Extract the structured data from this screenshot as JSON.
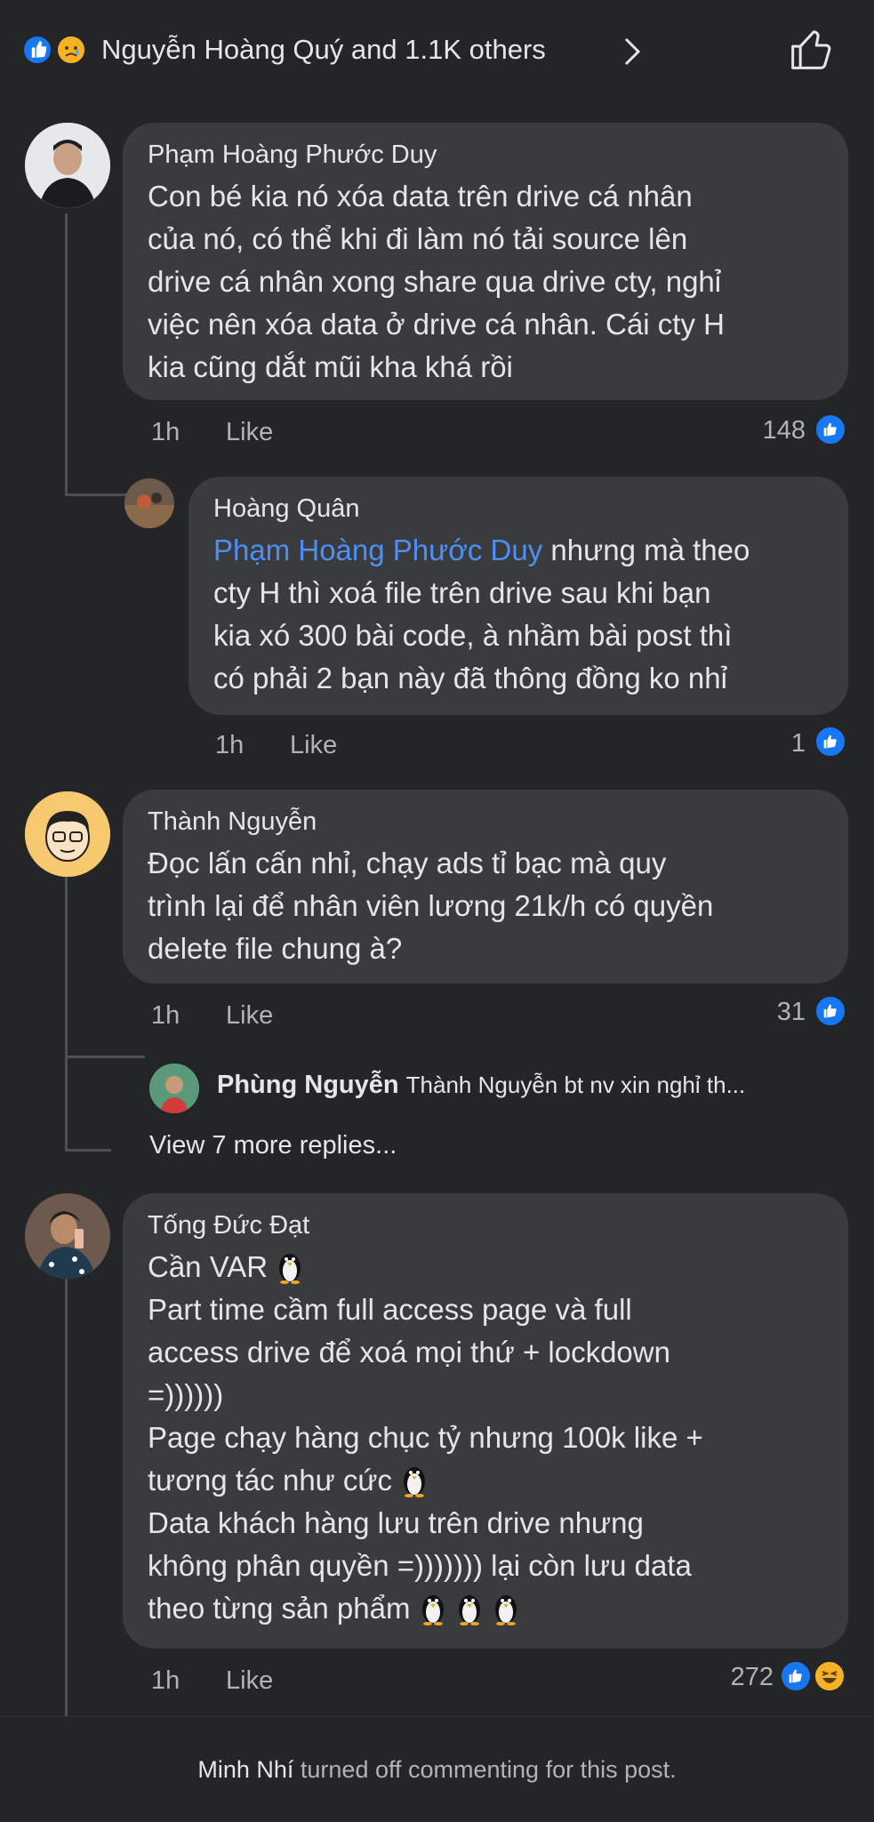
{
  "header": {
    "reaction_icons": [
      "like-icon",
      "sad-icon"
    ],
    "reactors_text": "Nguyễn Hoàng Quý and 1.1K others"
  },
  "comments": [
    {
      "author": "Phạm Hoàng Phước Duy",
      "text": "Con bé kia nó xóa data trên drive cá nhân\ncủa nó, có thể khi đi làm nó tải source lên\ndrive cá nhân xong share qua drive cty, nghỉ\nviệc nên xóa data ở drive cá nhân. Cái cty H\nkia cũng dắt mũi kha khá rồi",
      "time": "1h",
      "like_label": "Like",
      "reaction_count": "148"
    },
    {
      "author": "Hoàng Quân",
      "mention": "Phạm Hoàng Phước Duy",
      "text_line1_rest": " nhưng mà theo",
      "text_rest": "cty H thì xoá file trên drive sau khi bạn\nkia xó 300 bài code, à nhầm bài post thì\ncó phải 2 bạn này đã thông đồng ko nhỉ",
      "time": "1h",
      "like_label": "Like",
      "reaction_count": "1"
    },
    {
      "author": "Thành Nguyễn",
      "text": "Đọc lấn cấn nhỉ, chạy ads tỉ bạc mà quy\ntrình lại để nhân viên lương 21k/h có quyền\ndelete file chung à?",
      "time": "1h",
      "like_label": "Like",
      "reaction_count": "31",
      "reply_preview": {
        "name": "Phùng Nguyễn",
        "text": "Thành Nguyễn bt nv xin nghỉ th..."
      },
      "view_more": "View 7 more replies..."
    },
    {
      "author": "Tống Đức Đạt",
      "lines": [
        "Cần VAR",
        "Part time cầm full access page và full",
        "access drive để xoá mọi thứ + lockdown",
        "=))))))",
        "Page chạy hàng chục tỷ nhưng 100k like +",
        "tương tác như cức",
        "Data khách hàng lưu trên drive nhưng",
        "không phân quyền =))))))) lại còn lưu data",
        "theo từng sản phẩm"
      ],
      "time": "1h",
      "like_label": "Like",
      "reaction_count": "272"
    }
  ],
  "footer": {
    "name": "Minh Nhí",
    "text": " turned off commenting for this post."
  },
  "colors": {
    "background": "#242526",
    "bubble": "#3a3b3c",
    "like_blue": "#1877f2",
    "mention_blue": "#4d8ef7",
    "secondary_text": "#b0b3b8"
  }
}
